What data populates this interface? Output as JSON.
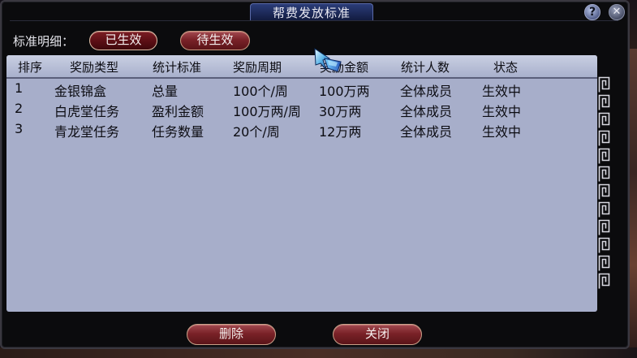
{
  "window": {
    "title": "帮费发放标准",
    "help_label": "?",
    "close_label": "✕"
  },
  "filter": {
    "label": "标准明细：",
    "tabs": [
      {
        "label": "已生效",
        "selected": true
      },
      {
        "label": "待生效",
        "selected": false
      }
    ]
  },
  "table": {
    "headers": [
      "排序",
      "奖励类型",
      "统计标准",
      "奖励周期",
      "奖励金额",
      "统计人数",
      "状态"
    ],
    "rows": [
      {
        "order": "1",
        "type": "金银锦盒",
        "standard": "总量",
        "period": "100个/周",
        "amount": "100万两",
        "scope": "全体成员",
        "status": "生效中"
      },
      {
        "order": "2",
        "type": "白虎堂任务",
        "standard": "盈利金额",
        "period": "100万两/周",
        "amount": "30万两",
        "scope": "全体成员",
        "status": "生效中"
      },
      {
        "order": "3",
        "type": "青龙堂任务",
        "standard": "任务数量",
        "period": "20个/周",
        "amount": "12万两",
        "scope": "全体成员",
        "status": "生效中"
      }
    ]
  },
  "buttons": {
    "delete": "删除",
    "close": "关闭"
  },
  "colors": {
    "accent_button": "#7a2228",
    "title_bar": "#1b2755",
    "table_bg": "#a7aeca"
  },
  "icons": {
    "cursor": "game-cursor-icon",
    "border_pattern": "meander-border-icon"
  }
}
